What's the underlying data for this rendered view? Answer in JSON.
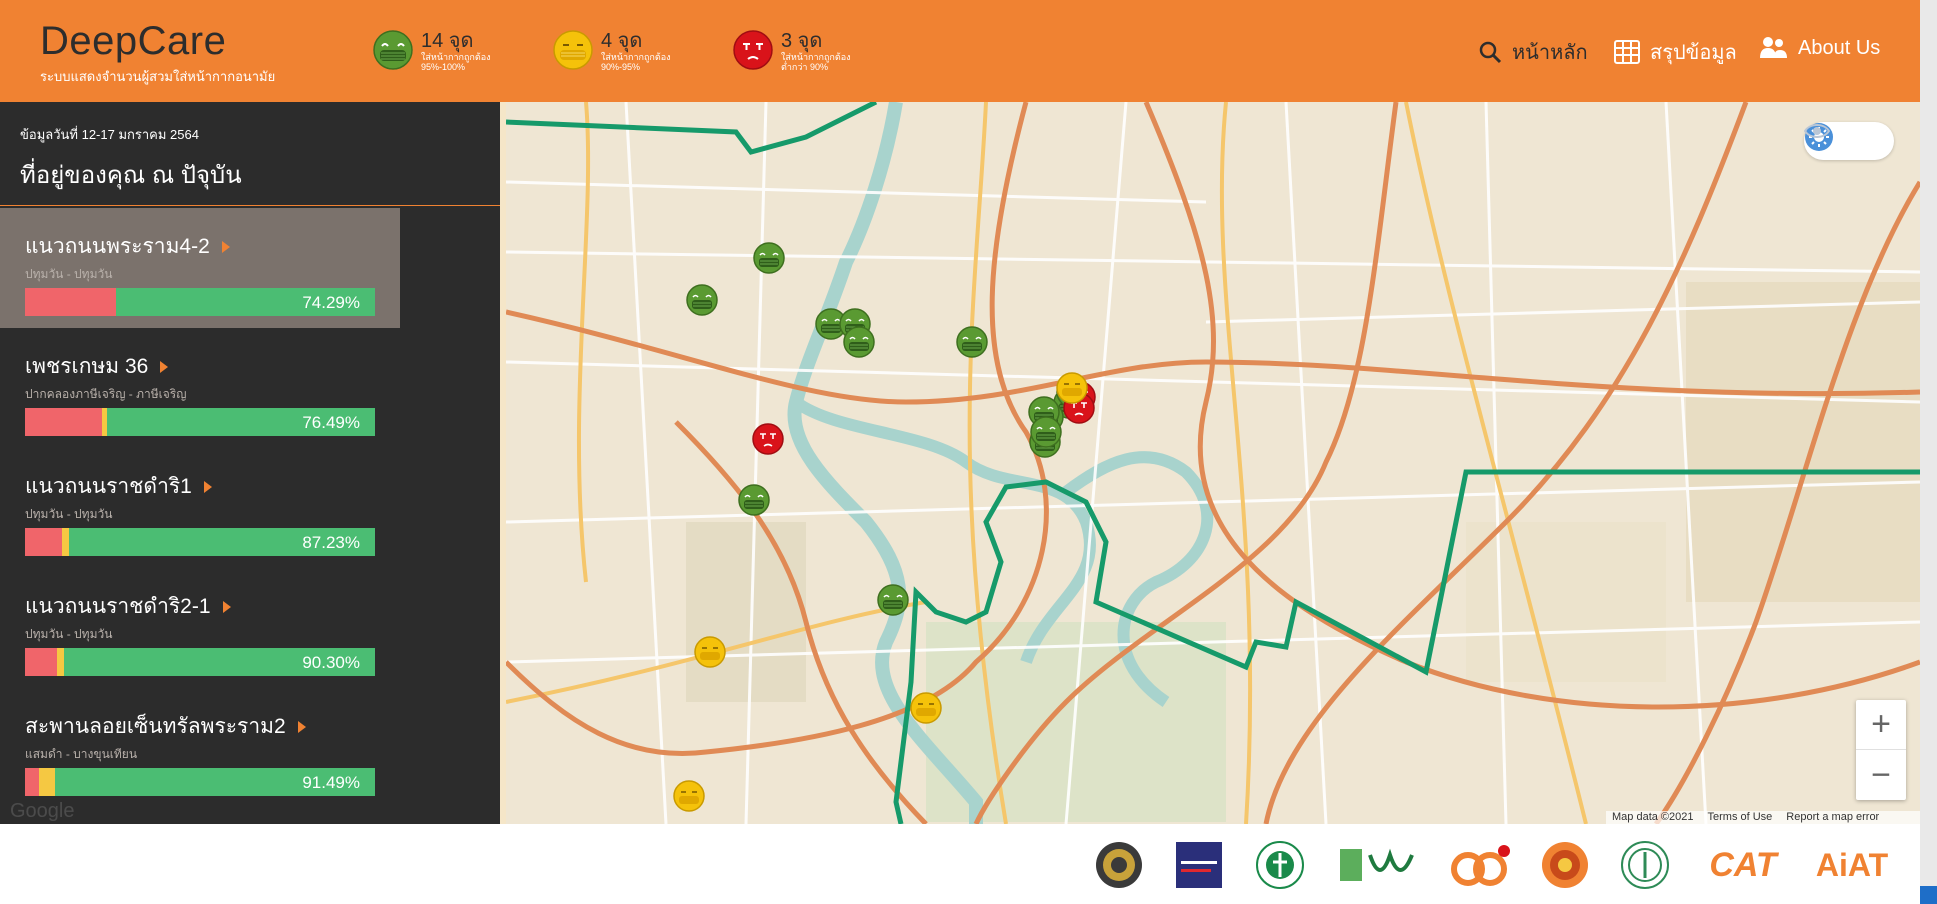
{
  "brand": {
    "title": "DeepCare",
    "subtitle": "ระบบแสดงจำนวนผู้สวมใส่หน้ากากอนามัย"
  },
  "legend": [
    {
      "count": "14 จุด",
      "desc1": "ใส่หน้ากากถูกต้อง",
      "desc2": "95%-100%",
      "color": "#4d8c2e"
    },
    {
      "count": "4 จุด",
      "desc1": "ใส่หน้ากากถูกต้อง",
      "desc2": "90%-95%",
      "color": "#f5c20a"
    },
    {
      "count": "3 จุด",
      "desc1": "ใส่หน้ากากถูกต้อง",
      "desc2": "ต่ำกว่า 90%",
      "color": "#d9131a"
    }
  ],
  "nav": {
    "home": "หน้าหลัก",
    "summary": "สรุปข้อมูล",
    "about": "About Us"
  },
  "sidebar": {
    "date": "ข้อมูลวันที่ 12-17 มกราคม 2564",
    "location": "ที่อยู่ของคุณ ณ ปัจุบัน",
    "items": [
      {
        "name": "แนวถนนพระราม4-2",
        "sub": "ปทุมวัน - ปทุมวัน",
        "percent": "74.29%",
        "red": 0.26,
        "yellow": 0.0
      },
      {
        "name": "เพชรเกษม 36",
        "sub": "ปากคลองภาษีเจริญ - ภาษีเจริญ",
        "percent": "76.49%",
        "red": 0.22,
        "yellow": 0.015
      },
      {
        "name": "แนวถนนราชดำริ1",
        "sub": "ปทุมวัน - ปทุมวัน",
        "percent": "87.23%",
        "red": 0.105,
        "yellow": 0.02
      },
      {
        "name": "แนวถนนราชดำริ2-1",
        "sub": "ปทุมวัน - ปทุมวัน",
        "percent": "90.30%",
        "red": 0.09,
        "yellow": 0.02
      },
      {
        "name": "สะพานลอยเซ็นทรัลพระราม2",
        "sub": "แสมดำ - บางขุนเทียน",
        "percent": "91.49%",
        "red": 0.04,
        "yellow": 0.045
      }
    ]
  },
  "map": {
    "attribution": [
      "Map data ©2021",
      "Terms of Use",
      "Report a map error"
    ],
    "google": "Google",
    "zoom_in": "+",
    "zoom_out": "−"
  },
  "colors": {
    "header": "#f08232",
    "sidebar": "#2c2c2c",
    "green": "#4bbd73",
    "red": "#f0656a",
    "yellow": "#f5c842"
  },
  "footer": {
    "logos": [
      "emblem-logo",
      "covid-center-logo",
      "health-dept-logo",
      "rsc-logo",
      "anniversary-logo",
      "university-seal-logo",
      "bma-logo",
      "CAT",
      "AiAT"
    ]
  }
}
